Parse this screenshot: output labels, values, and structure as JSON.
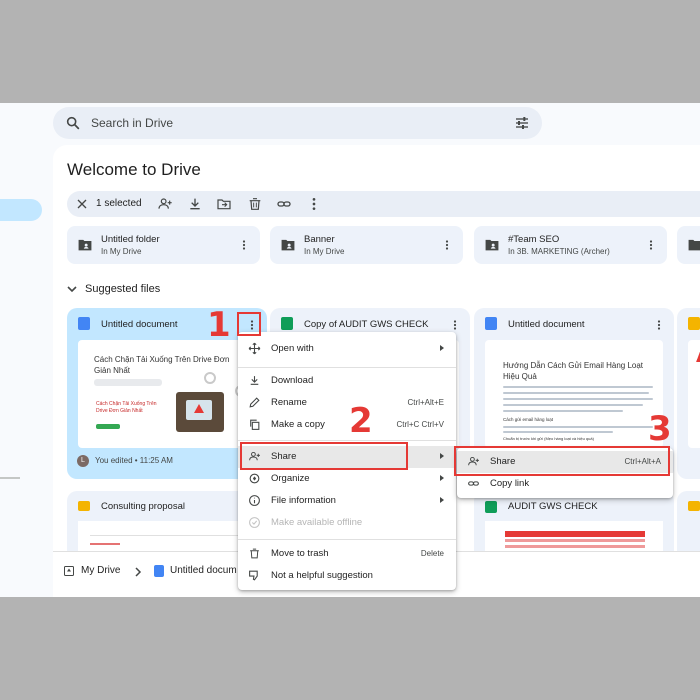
{
  "search": {
    "placeholder": "Search in Drive"
  },
  "page": {
    "title": "Welcome to Drive"
  },
  "toolbar": {
    "selected_label": "1 selected"
  },
  "folders": [
    {
      "name": "Untitled folder",
      "location": "In My Drive"
    },
    {
      "name": "Banner",
      "location": "In My Drive"
    },
    {
      "name": "#Team SEO",
      "location": "In 3B. MARKETING (Archer)"
    }
  ],
  "suggested": {
    "heading": "Suggested files",
    "files": [
      {
        "name": "Untitled document",
        "activity": "You edited • 11:25 AM",
        "avatar": "L",
        "thumb_title": "Cách Chặn Tải Xuống Trên Drive Đơn Giản Nhất",
        "thumb_sub": "Cách Chặn Tải Xuống Trên Drive Đơn Giản Nhất"
      },
      {
        "name": "Copy of AUDIT GWS CHECK"
      },
      {
        "name": "Untitled document",
        "thumb_title": "Hướng Dẫn Cách Gửi Email Hàng Loạt Hiệu Quả",
        "thumb_sub1": "Cách gửi email hàng loạt",
        "thumb_sub2": "Chuẩn bị trước khi gửi (Mẹo hàng loạt và hiệu quả)"
      }
    ],
    "row2": [
      {
        "name": "Consulting proposal"
      },
      {
        "name": "AUDIT GWS CHECK"
      }
    ]
  },
  "breadcrumb": {
    "root": "My Drive",
    "current": "Untitled docum"
  },
  "context_menu": {
    "items": [
      {
        "label": "Open with",
        "shortcut": ""
      },
      {
        "label": "Download",
        "shortcut": ""
      },
      {
        "label": "Rename",
        "shortcut": "Ctrl+Alt+E"
      },
      {
        "label": "Make a copy",
        "shortcut": "Ctrl+C Ctrl+V"
      },
      {
        "label": "Share",
        "shortcut": ""
      },
      {
        "label": "Organize",
        "shortcut": ""
      },
      {
        "label": "File information",
        "shortcut": ""
      },
      {
        "label": "Make available offline",
        "shortcut": ""
      },
      {
        "label": "Move to trash",
        "shortcut": "Delete"
      },
      {
        "label": "Not a helpful suggestion",
        "shortcut": ""
      }
    ]
  },
  "share_submenu": {
    "items": [
      {
        "label": "Share",
        "shortcut": "Ctrl+Alt+A"
      },
      {
        "label": "Copy link",
        "shortcut": ""
      }
    ]
  },
  "annotations": {
    "step1": "1",
    "step2": "2",
    "step3": "3"
  },
  "colors": {
    "accent_blue": "#c2e7ff",
    "annotation_red": "#e53935",
    "docs_blue": "#4285f4",
    "sheets_green": "#0f9d58",
    "slides_yellow": "#f4b400"
  },
  "icons": [
    "search-icon",
    "filter-icon",
    "close-icon",
    "add-person-icon",
    "download-icon",
    "move-folder-icon",
    "trash-icon",
    "link-icon",
    "more-vert-icon",
    "folder-shared-icon",
    "chevron-down-icon",
    "move-icon",
    "pencil-icon",
    "copy-icon",
    "info-icon",
    "offline-icon",
    "dislike-icon",
    "drive-icon",
    "docs-icon",
    "sheets-icon",
    "slides-icon"
  ]
}
